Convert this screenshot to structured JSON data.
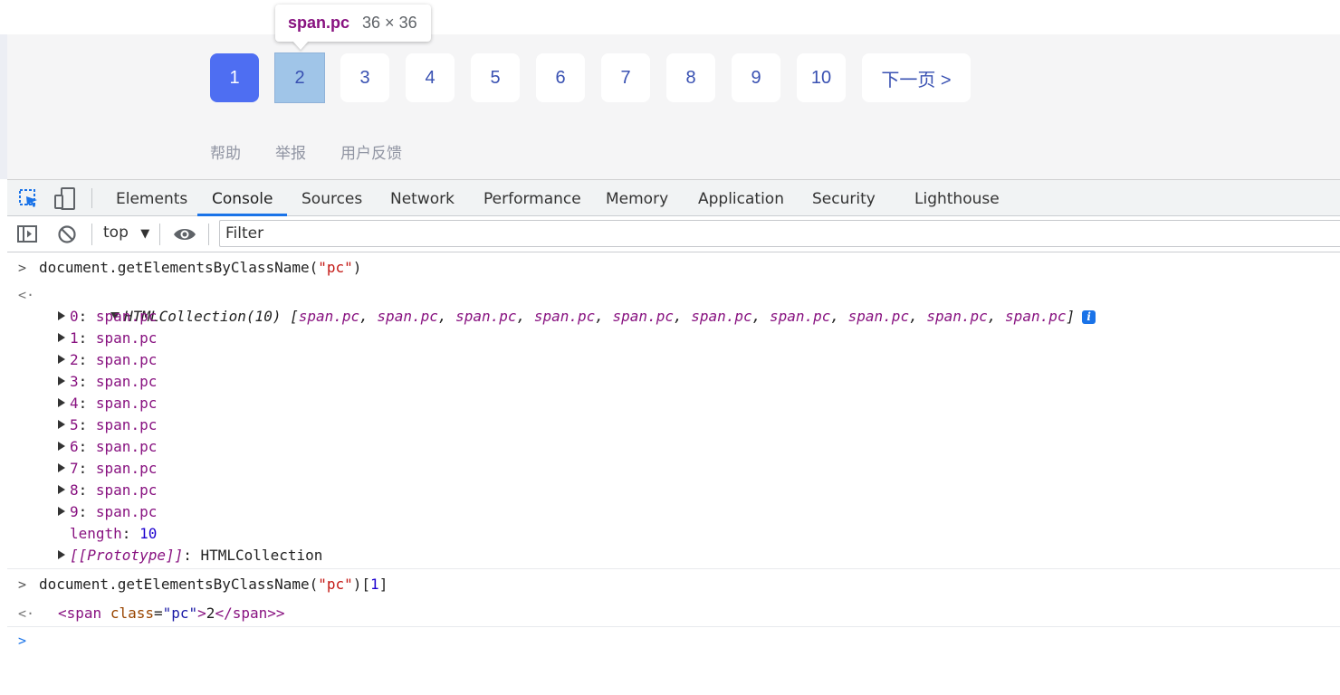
{
  "page": {
    "pagination": [
      "1",
      "2",
      "3",
      "4",
      "5",
      "6",
      "7",
      "8",
      "9",
      "10"
    ],
    "next_label": "下一页 >",
    "current_page": "1",
    "hovered_page": "2",
    "footer_links": [
      "帮助",
      "举报",
      "用户反馈"
    ]
  },
  "tooltip": {
    "selector": "span.pc",
    "size": "36 × 36"
  },
  "devtools": {
    "tabs": [
      "Elements",
      "Console",
      "Sources",
      "Network",
      "Performance",
      "Memory",
      "Application",
      "Security",
      "Lighthouse"
    ],
    "active_tab": "Console",
    "context": "top",
    "filter_placeholder": "Filter"
  },
  "console": {
    "cmd1": {
      "prefix": "document.getElementsByClassName(",
      "arg": "\"pc\"",
      "suffix": ")"
    },
    "result1": {
      "head": "HTMLCollection(10)",
      "open": " [",
      "items": [
        "span.pc",
        "span.pc",
        "span.pc",
        "span.pc",
        "span.pc",
        "span.pc",
        "span.pc",
        "span.pc",
        "span.pc",
        "span.pc"
      ],
      "close": "]",
      "entries": [
        {
          "key": "0",
          "value": "span.pc"
        },
        {
          "key": "1",
          "value": "span.pc"
        },
        {
          "key": "2",
          "value": "span.pc"
        },
        {
          "key": "3",
          "value": "span.pc"
        },
        {
          "key": "4",
          "value": "span.pc"
        },
        {
          "key": "5",
          "value": "span.pc"
        },
        {
          "key": "6",
          "value": "span.pc"
        },
        {
          "key": "7",
          "value": "span.pc"
        },
        {
          "key": "8",
          "value": "span.pc"
        },
        {
          "key": "9",
          "value": "span.pc"
        }
      ],
      "length_key": "length",
      "length_value": "10",
      "proto_key": "[[Prototype]]",
      "proto_value": "HTMLCollection"
    },
    "cmd2": {
      "prefix": "document.getElementsByClassName(",
      "arg": "\"pc\"",
      "mid": ")[",
      "index": "1",
      "suffix": "]"
    },
    "result2": {
      "tag_open": "<span",
      "attr_name": "class",
      "attr_value": "\"pc\"",
      "text": "2",
      "tag_close": "</span>"
    }
  },
  "colors": {
    "accent": "#1a73e8",
    "current_page_bg": "#4e6ef2",
    "hover_bg": "#a0c5e8",
    "tag": "#881280",
    "string": "#c41a16"
  }
}
